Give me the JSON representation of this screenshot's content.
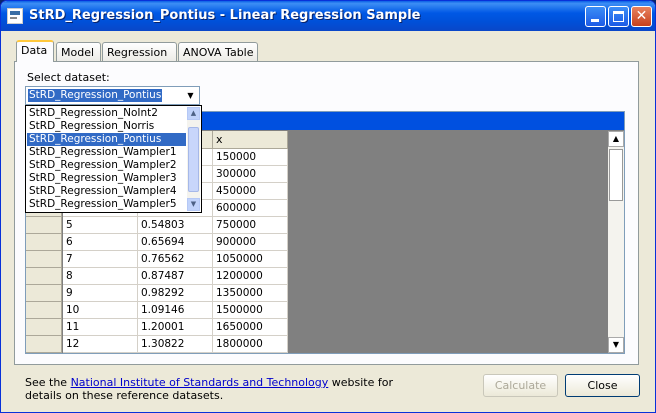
{
  "window": {
    "title": "StRD_Regression_Pontius - Linear Regression Sample"
  },
  "tabs": [
    {
      "label": "Data",
      "active": true
    },
    {
      "label": "Model",
      "active": false
    },
    {
      "label": "Regression",
      "active": false
    },
    {
      "label": "ANOVA Table",
      "active": false
    }
  ],
  "dataset": {
    "label": "Select dataset:",
    "selected": "StRD_Regression_Pontius",
    "options": [
      "StRD_Regression_NoInt2",
      "StRD_Regression_Norris",
      "StRD_Regression_Pontius",
      "StRD_Regression_Wampler1",
      "StRD_Regression_Wampler2",
      "StRD_Regression_Wampler3",
      "StRD_Regression_Wampler4",
      "StRD_Regression_Wampler5"
    ]
  },
  "grid": {
    "column_x": "x",
    "rows": [
      {
        "id": "",
        "y": "",
        "x": "150000"
      },
      {
        "id": "",
        "y": "",
        "x": "300000"
      },
      {
        "id": "",
        "y": "",
        "x": "450000"
      },
      {
        "id": "",
        "y": "",
        "x": "600000"
      },
      {
        "id": "5",
        "y": "0.54803",
        "x": "750000"
      },
      {
        "id": "6",
        "y": "0.65694",
        "x": "900000"
      },
      {
        "id": "7",
        "y": "0.76562",
        "x": "1050000"
      },
      {
        "id": "8",
        "y": "0.87487",
        "x": "1200000"
      },
      {
        "id": "9",
        "y": "0.98292",
        "x": "1350000"
      },
      {
        "id": "10",
        "y": "1.09146",
        "x": "1500000"
      },
      {
        "id": "11",
        "y": "1.20001",
        "x": "1650000"
      },
      {
        "id": "12",
        "y": "1.30822",
        "x": "1800000"
      }
    ]
  },
  "footer": {
    "text_before": "See the ",
    "link": "National Institute of Standards and Technology",
    "text_after": " website for details on these reference datasets."
  },
  "buttons": {
    "calculate": "Calculate",
    "close": "Close"
  }
}
